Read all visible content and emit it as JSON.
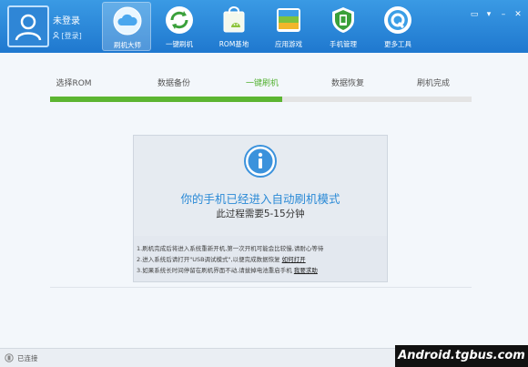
{
  "header": {
    "user_name": "未登录",
    "user_login": "[登录]",
    "nav": [
      {
        "label": "刷机大师",
        "icon": "cloud-icon",
        "active": true
      },
      {
        "label": "一键刷机",
        "icon": "refresh-icon",
        "active": false
      },
      {
        "label": "ROM基地",
        "icon": "rom-bag-icon",
        "active": false
      },
      {
        "label": "应用游戏",
        "icon": "apps-icon",
        "active": false
      },
      {
        "label": "手机管理",
        "icon": "shield-icon",
        "active": false
      },
      {
        "label": "更多工具",
        "icon": "tools-icon",
        "active": false
      }
    ]
  },
  "steps": {
    "items": [
      "选择ROM",
      "数据备份",
      "一键刷机",
      "数据恢复",
      "刷机完成"
    ],
    "current_index": 2,
    "progress_fraction": 0.55
  },
  "card": {
    "title": "你的手机已经进入自动刷机模式",
    "subtitle": "此过程需要5-15分钟",
    "notes": [
      {
        "text": "1.刷机完成后将进入系统重新开机,第一次开机可能会比较慢,请耐心等待",
        "link": ""
      },
      {
        "text": "2.进入系统后请打开\"USB调试模式\",以便完成数据恢复 ",
        "link": "如何打开"
      },
      {
        "text": "3.如果系统长时间停留在刷机界面不动,请拔掉电池重启手机 ",
        "link": "我要求助"
      }
    ]
  },
  "status": {
    "text": "已连接"
  },
  "watermark": "Android.tgbus.com",
  "colors": {
    "header": "#1f78cf",
    "progress": "#5cb531",
    "title": "#2b8ad6"
  }
}
